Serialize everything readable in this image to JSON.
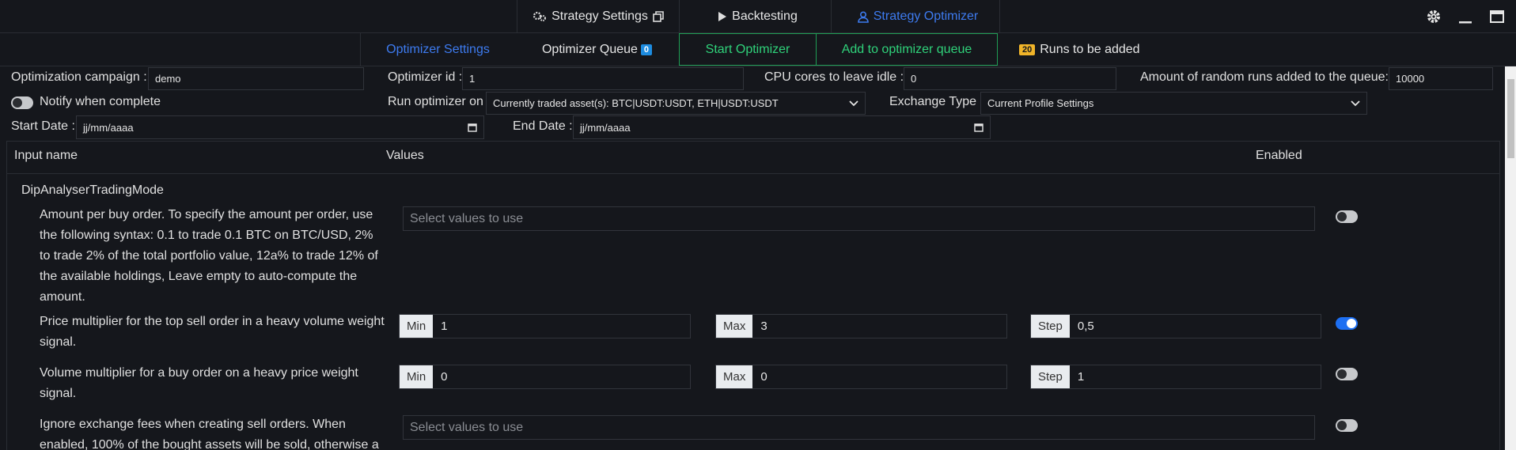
{
  "topnav": {
    "tabs": [
      {
        "label": "Strategy Settings",
        "icon": "gears-icon",
        "trailing_icon": "window-restore-icon"
      },
      {
        "label": "Backtesting",
        "icon": "play-icon"
      },
      {
        "label": "Strategy Optimizer",
        "icon": "user-icon",
        "active": true
      }
    ],
    "window_controls": [
      "gear-icon",
      "minimize-icon",
      "maximize-icon"
    ]
  },
  "subnav": {
    "optimizer_settings": "Optimizer Settings",
    "optimizer_queue": "Optimizer Queue",
    "queue_count": "0",
    "start_optimizer": "Start Optimizer",
    "add_to_queue": "Add to optimizer queue",
    "runs_count": "20",
    "runs_label": "Runs to be added"
  },
  "form": {
    "campaign_label": "Optimization campaign :",
    "campaign_value": "demo",
    "optimizer_id_label": "Optimizer id :",
    "optimizer_id_value": "1",
    "cpu_label": "CPU cores to leave idle :",
    "cpu_value": "0",
    "random_runs_label": "Amount of random runs added to the queue:",
    "random_runs_value": "10000",
    "notify_label": "Notify when complete",
    "notify_on": false,
    "run_on_label": "Run optimizer on",
    "run_on_value": "Currently traded asset(s): BTC|USDT:USDT, ETH|USDT:USDT",
    "exchange_type_label": "Exchange Type",
    "exchange_type_value": "Current Profile Settings",
    "start_date_label": "Start Date :",
    "start_date_value": "jj/mm/aaaa",
    "end_date_label": "End Date :",
    "end_date_value": "jj/mm/aaaa"
  },
  "table": {
    "headers": {
      "input_name": "Input name",
      "values": "Values",
      "enabled": "Enabled"
    },
    "group": "DipAnalyserTradingMode",
    "rows": [
      {
        "lines": [
          "Amount per buy order. To specify the amount per order, use",
          "the following syntax: 0.1 to trade 0.1 BTC on BTC/USD, 2%",
          "to trade 2% of the total portfolio value, 12a% to trade 12% of",
          "the available holdings, Leave empty to auto-compute the",
          "amount."
        ],
        "placeholder": "Select values to use",
        "enabled": false
      },
      {
        "lines": [
          "Price multiplier for the top sell order in a heavy volume weight",
          "signal."
        ],
        "min_label": "Min",
        "min": "1",
        "max_label": "Max",
        "max": "3",
        "step_label": "Step",
        "step": "0,5",
        "enabled": true
      },
      {
        "lines": [
          "Volume multiplier for a buy order on a heavy price weight",
          "signal."
        ],
        "min_label": "Min",
        "min": "0",
        "max_label": "Max",
        "max": "0",
        "step_label": "Step",
        "step": "1",
        "enabled": false
      },
      {
        "lines": [
          "Ignore exchange fees when creating sell orders. When",
          "enabled, 100% of the bought assets will be sold, otherwise a"
        ],
        "placeholder": "Select values to use",
        "enabled": false
      }
    ]
  },
  "colors": {
    "accent_blue": "#3d7bf0",
    "green": "#2fd27a",
    "background": "#15171c"
  }
}
